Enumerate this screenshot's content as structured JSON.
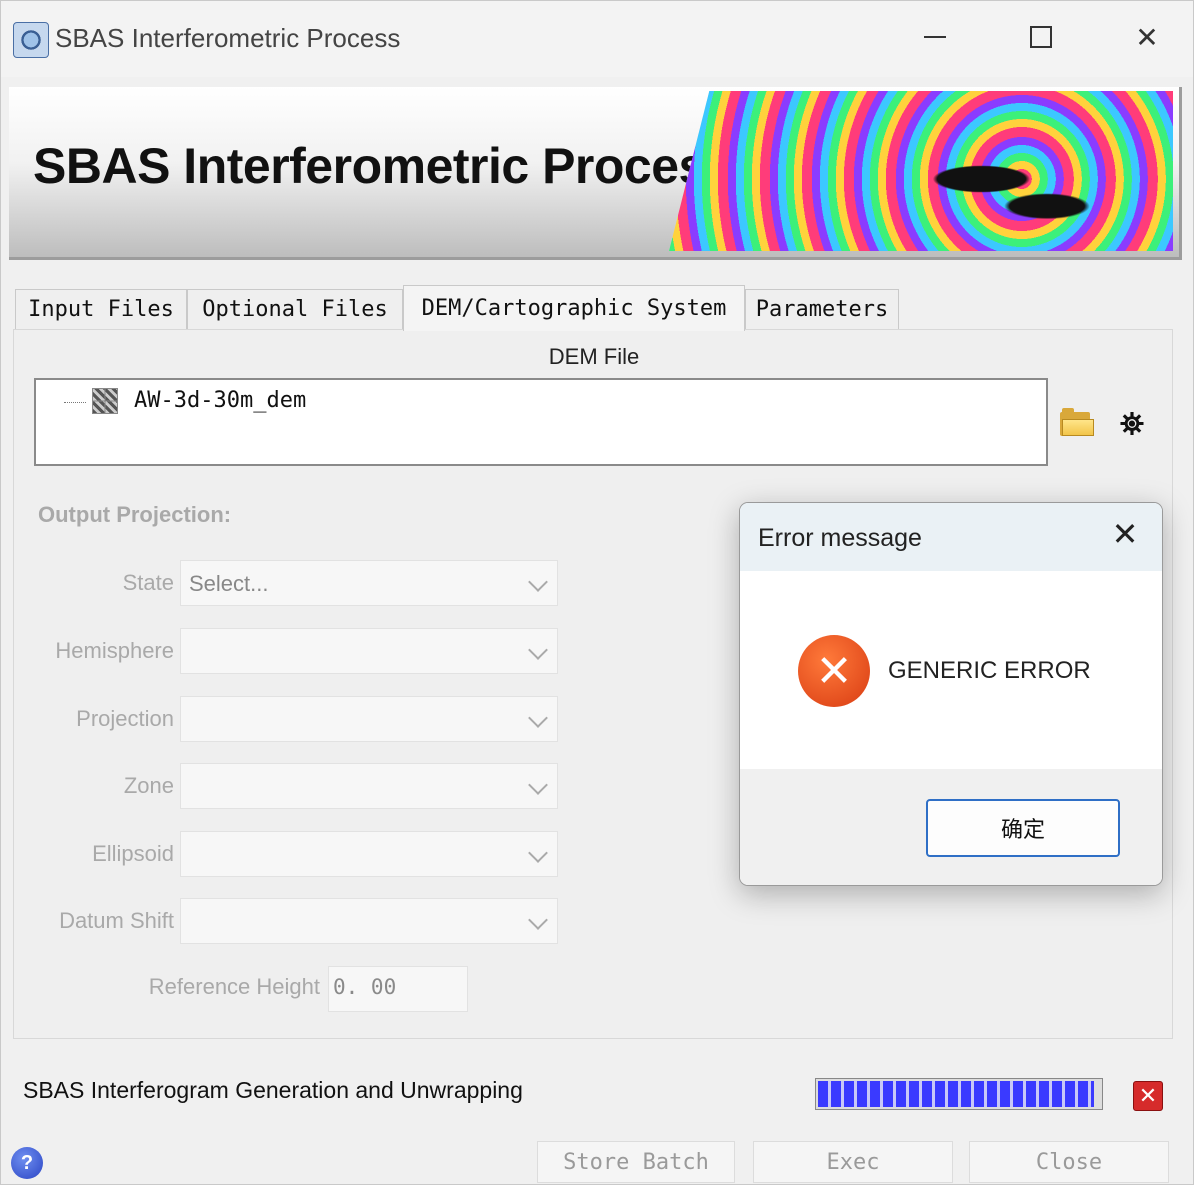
{
  "window": {
    "title": "SBAS Interferometric Process",
    "minimize_glyph": "—",
    "close_glyph": "✕"
  },
  "banner": {
    "title": "SBAS Interferometric Process"
  },
  "tabs": [
    {
      "label": "Input Files",
      "active": false
    },
    {
      "label": "Optional Files",
      "active": false
    },
    {
      "label": "DEM/Cartographic System",
      "active": true
    },
    {
      "label": "Parameters",
      "active": false
    }
  ],
  "dem": {
    "section_label": "DEM File",
    "file_name": "AW-3d-30m_dem",
    "binoculars_glyph": "⛯"
  },
  "projection": {
    "heading": "Output Projection:",
    "fields": [
      {
        "label": "State",
        "value": "Select..."
      },
      {
        "label": "Hemisphere",
        "value": ""
      },
      {
        "label": "Projection",
        "value": ""
      },
      {
        "label": "Zone",
        "value": ""
      },
      {
        "label": "Ellipsoid",
        "value": ""
      },
      {
        "label": "Datum Shift",
        "value": ""
      }
    ],
    "reference_height_label": "Reference Height",
    "reference_height_value": "0. 00"
  },
  "status": {
    "text": "SBAS Interferogram Generation and Unwrapping",
    "progress_fraction": 0.98,
    "cancel_glyph": "✕"
  },
  "help_glyph": "?",
  "buttons": {
    "store_batch": "Store Batch",
    "exec": "Exec",
    "close": "Close"
  },
  "dialog": {
    "title": "Error message",
    "close_glyph": "✕",
    "error_glyph": "✕",
    "message": "GENERIC ERROR",
    "ok_label": "确定"
  },
  "colors": {
    "dialog_ok_border": "#2f6fc6",
    "error_icon": "#e0461a",
    "progress_fill": "#3a3aff"
  }
}
